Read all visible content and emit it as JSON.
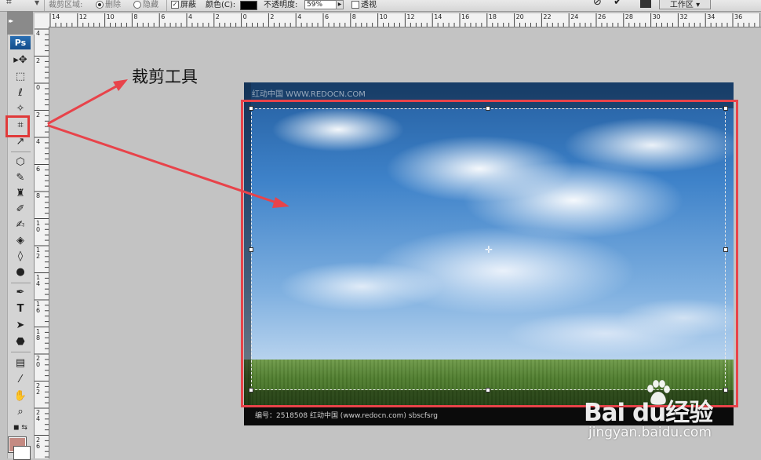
{
  "option_bar": {
    "crop_area_label": "裁剪区域:",
    "delete_label": "删除",
    "hide_label": "隐藏",
    "shield_label": "屏蔽",
    "color_label": "颜色(C):",
    "opacity_label": "不透明度:",
    "opacity_value": "59%",
    "perspective_label": "透视",
    "workspace_label": "工作区"
  },
  "toolbox": {
    "logo": "Ps"
  },
  "rulers": {
    "top_ticks": [
      "14",
      "12",
      "10",
      "8",
      "6",
      "4",
      "2",
      "0",
      "2",
      "4",
      "6",
      "8",
      "10",
      "12",
      "14",
      "16",
      "18",
      "20",
      "22",
      "24",
      "26",
      "28",
      "30",
      "32",
      "34",
      "36"
    ],
    "left_ticks": [
      "4",
      "2",
      "0",
      "2",
      "4",
      "6",
      "8",
      "10",
      "12",
      "14",
      "16",
      "18",
      "20",
      "22",
      "24",
      "26"
    ]
  },
  "annotation": {
    "label": "裁剪工具"
  },
  "document": {
    "watermark": "红动中国 WWW.REDOCN.COM",
    "footer": "编号：2518508    红动中国 (www.redocn.com)    sbscfsrg"
  },
  "watermark": {
    "brand": "Bai   du经验",
    "url": "jingyan.baidu.com"
  },
  "colors": {
    "highlight_red": "#e8434a",
    "foreground_swatch": "#c48a82"
  }
}
